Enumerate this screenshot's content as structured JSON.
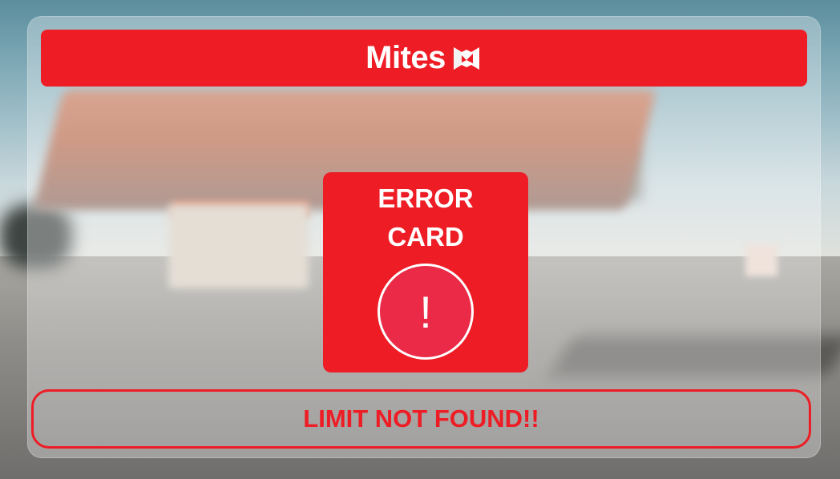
{
  "brand": {
    "name": "Mites",
    "logo_icon": "mites-logo-icon",
    "color": "#ee1c25"
  },
  "error_card": {
    "line1": "ERROR",
    "line2": "CARD",
    "icon": "exclamation-icon",
    "icon_glyph": "!",
    "color": "#ee1c25"
  },
  "message": {
    "text": "LIMIT NOT FOUND!!"
  },
  "background": {
    "image": "blurred-gas-station-photo"
  }
}
